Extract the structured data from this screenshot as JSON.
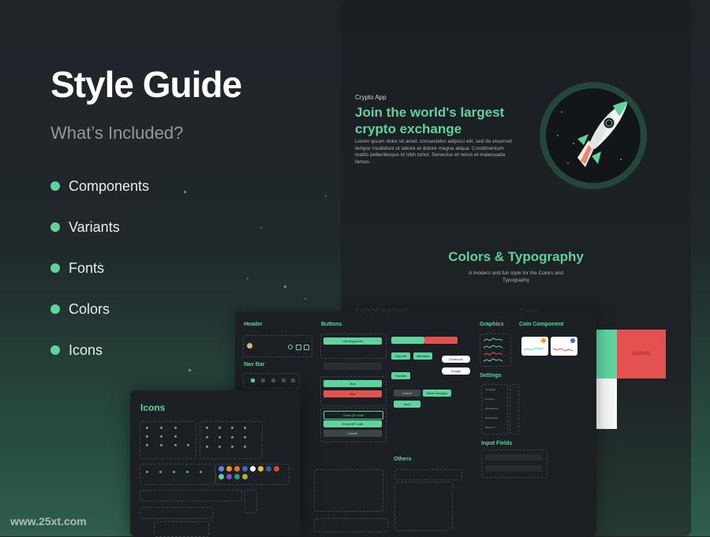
{
  "hero": {
    "title": "Style Guide",
    "subtitle": "What’s Included?",
    "features": [
      "Components",
      "Variants",
      "Fonts",
      "Colors",
      "Icons"
    ]
  },
  "colors": {
    "accent": "#5ed39e",
    "danger": "#e45151",
    "background": "#1f2429"
  },
  "app_card": {
    "eyebrow": "Crypto App",
    "headline": "Join the world's largest crypto exchange",
    "body": "Lorem ipsum dolor sit amet, consectetur adipisci elit, sed do eiusmod tempor incididunt ut labore et dolore magna aliqua. Condimentum mattis pellentesque id nibh tortor. Senectus et netus et malesuada fames.",
    "section_title": "Colors & Typography",
    "section_sub": "A modern and fun style for the Colors and Typography",
    "ghost_left": "TYPOGRAPHY",
    "ghost_right": "Colors",
    "swatch_red_hex": "#E45151"
  },
  "components": {
    "header": "Header",
    "navbar": "Nav Bar",
    "buttons": "Buttons",
    "graphics": "Graphics",
    "coin_component": "Coin Component",
    "settings": "Settings",
    "input_fields": "Input Fields",
    "others": "Others",
    "button_labels": {
      "fingerprint": "Use fingerprint",
      "buy": "Buy",
      "sell": "Sell",
      "scan_qr": "Scan QR code",
      "show_qr": "Show QR code",
      "cancel": "Cancel",
      "deposit": "Deposit",
      "withdraw": "Withdraw",
      "transfer": "Transfer",
      "save_changes": "Save Changes",
      "next": "Next",
      "facebook": "Facebook",
      "google": "Google"
    },
    "settings_items": [
      "Language",
      "Currency",
      "Appearance",
      "Preferences",
      "About Us"
    ]
  },
  "icons_panel": {
    "title": "Icons"
  },
  "watermark": "www.25xt.com"
}
